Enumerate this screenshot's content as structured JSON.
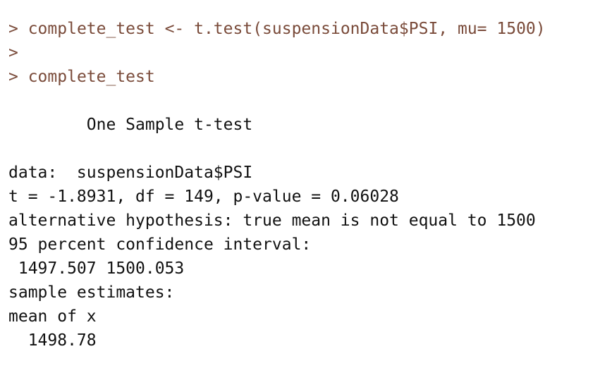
{
  "console": {
    "prompt_symbol": ">",
    "lines": [
      {
        "kind": "input",
        "prompt": ">",
        "text": " complete_test <- t.test(suspensionData$PSI, mu= 1500)"
      },
      {
        "kind": "input",
        "prompt": ">",
        "text": ""
      },
      {
        "kind": "input",
        "prompt": ">",
        "text": " complete_test"
      },
      {
        "kind": "output",
        "text": ""
      },
      {
        "kind": "output",
        "text": "        One Sample t-test"
      },
      {
        "kind": "output",
        "text": ""
      },
      {
        "kind": "output",
        "text": "data:  suspensionData$PSI"
      },
      {
        "kind": "output",
        "text": "t = -1.8931, df = 149, p-value = 0.06028"
      },
      {
        "kind": "output",
        "text": "alternative hypothesis: true mean is not equal to 1500"
      },
      {
        "kind": "output",
        "text": "95 percent confidence interval:"
      },
      {
        "kind": "output",
        "text": " 1497.507 1500.053"
      },
      {
        "kind": "output",
        "text": "sample estimates:"
      },
      {
        "kind": "output",
        "text": "mean of x"
      },
      {
        "kind": "output",
        "text": "  1498.78"
      }
    ]
  },
  "colors": {
    "background": "#ffffff",
    "input_text": "#7a4b3a",
    "output_text": "#111111"
  }
}
